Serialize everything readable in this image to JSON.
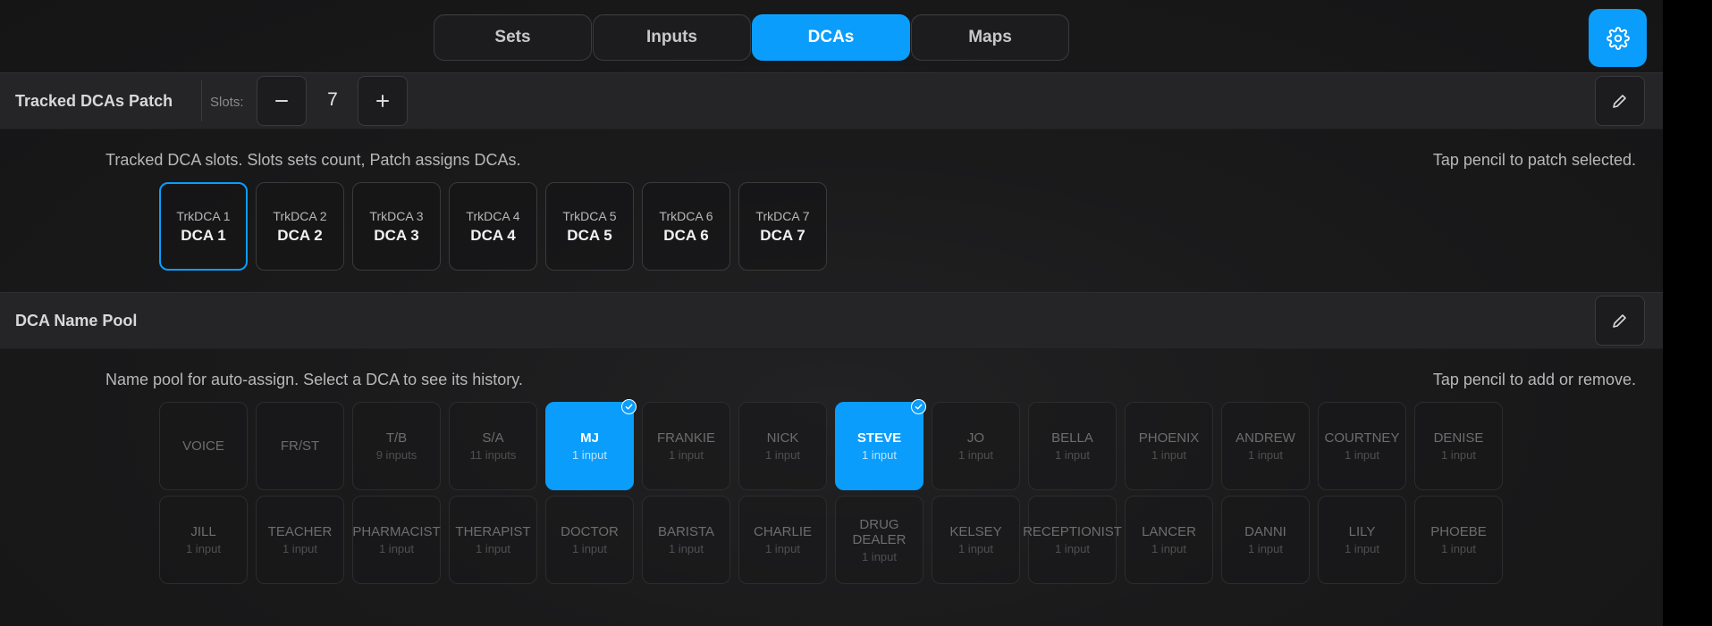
{
  "tabs": [
    {
      "label": "Sets",
      "active": false
    },
    {
      "label": "Inputs",
      "active": false
    },
    {
      "label": "DCAs",
      "active": true
    },
    {
      "label": "Maps",
      "active": false
    }
  ],
  "tracked": {
    "title": "Tracked DCAs Patch",
    "slots_label": "Slots:",
    "slot_count": "7",
    "description": "Tracked DCA slots. Slots sets count, Patch assigns DCAs.",
    "hint": "Tap pencil to patch selected.",
    "slots": [
      {
        "top": "TrkDCA 1",
        "main": "DCA 1",
        "selected": true
      },
      {
        "top": "TrkDCA 2",
        "main": "DCA 2"
      },
      {
        "top": "TrkDCA 3",
        "main": "DCA 3"
      },
      {
        "top": "TrkDCA 4",
        "main": "DCA 4"
      },
      {
        "top": "TrkDCA 5",
        "main": "DCA 5"
      },
      {
        "top": "TrkDCA 6",
        "main": "DCA 6"
      },
      {
        "top": "TrkDCA 7",
        "main": "DCA 7"
      }
    ]
  },
  "pool": {
    "title": "DCA Name Pool",
    "description": "Name pool for auto-assign. Select a DCA to see its history.",
    "hint": "Tap pencil to add or remove.",
    "row1": [
      {
        "name": "VOICE",
        "sub": ""
      },
      {
        "name": "FR/ST",
        "sub": ""
      },
      {
        "name": "T/B",
        "sub": "9 inputs"
      },
      {
        "name": "S/A",
        "sub": "11 inputs"
      },
      {
        "name": "MJ",
        "sub": "1 input",
        "selected": true
      },
      {
        "name": "FRANKIE",
        "sub": "1 input"
      },
      {
        "name": "NICK",
        "sub": "1 input"
      },
      {
        "name": "STEVE",
        "sub": "1 input",
        "selected": true
      },
      {
        "name": "JO",
        "sub": "1 input"
      },
      {
        "name": "BELLA",
        "sub": "1 input"
      },
      {
        "name": "PHOENIX",
        "sub": "1 input"
      },
      {
        "name": "ANDREW",
        "sub": "1 input"
      },
      {
        "name": "COURTNEY",
        "sub": "1 input"
      },
      {
        "name": "DENISE",
        "sub": "1 input"
      }
    ],
    "row2": [
      {
        "name": "JILL",
        "sub": "1 input"
      },
      {
        "name": "TEACHER",
        "sub": "1 input"
      },
      {
        "name": "PHARMACIST",
        "sub": "1 input"
      },
      {
        "name": "THERAPIST",
        "sub": "1 input"
      },
      {
        "name": "DOCTOR",
        "sub": "1 input"
      },
      {
        "name": "BARISTA",
        "sub": "1 input"
      },
      {
        "name": "CHARLIE",
        "sub": "1 input"
      },
      {
        "name": "DRUG\nDEALER",
        "sub": "1 input"
      },
      {
        "name": "KELSEY",
        "sub": "1 input"
      },
      {
        "name": "RECEPTIONIST",
        "sub": "1 input"
      },
      {
        "name": "LANCER",
        "sub": "1 input"
      },
      {
        "name": "DANNI",
        "sub": "1 input"
      },
      {
        "name": "LILY",
        "sub": "1 input"
      },
      {
        "name": "PHOEBE",
        "sub": "1 input"
      }
    ]
  },
  "colors": {
    "accent": "#0a9dfc",
    "background": "#1a1a1b"
  },
  "icons": {
    "settings": "gear-icon",
    "minus": "minus-icon",
    "plus": "plus-icon",
    "edit": "pencil-icon",
    "check": "check-icon"
  }
}
